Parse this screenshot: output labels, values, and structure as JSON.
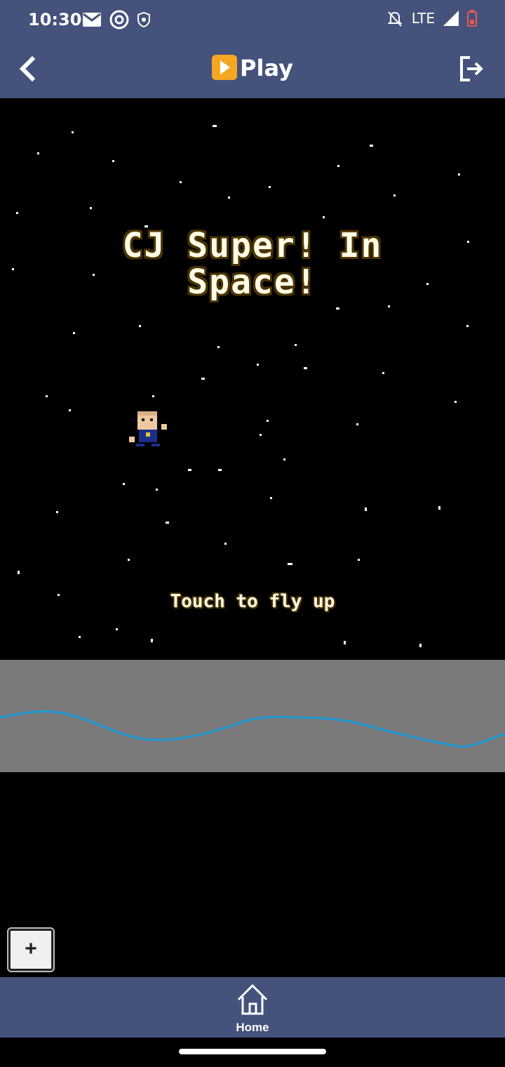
{
  "status_bar": {
    "time": "10:30",
    "network": "LTE",
    "icons": [
      "mail-icon",
      "at-sign-icon",
      "shield-icon",
      "bell-off-icon",
      "signal-icon",
      "battery-low-icon"
    ]
  },
  "app_bar": {
    "title": "Play",
    "back_icon": "back-chevron-icon",
    "exit_icon": "exit-icon"
  },
  "game": {
    "title_line1": "CJ Super! In",
    "title_line2": "Space!",
    "hint": "Touch to fly up",
    "colors": {
      "sky": "#000000",
      "ground": "#7a7a7a",
      "wave": "#1e9bd7",
      "title_text": "#fffbe6",
      "title_outline": "#4a3400"
    }
  },
  "zoom_button": {
    "label": "+"
  },
  "bottom_nav": {
    "home_label": "Home",
    "home_icon": "home-icon"
  },
  "colors": {
    "bar_bg": "#44527c",
    "accent_play": "#f5a623"
  }
}
